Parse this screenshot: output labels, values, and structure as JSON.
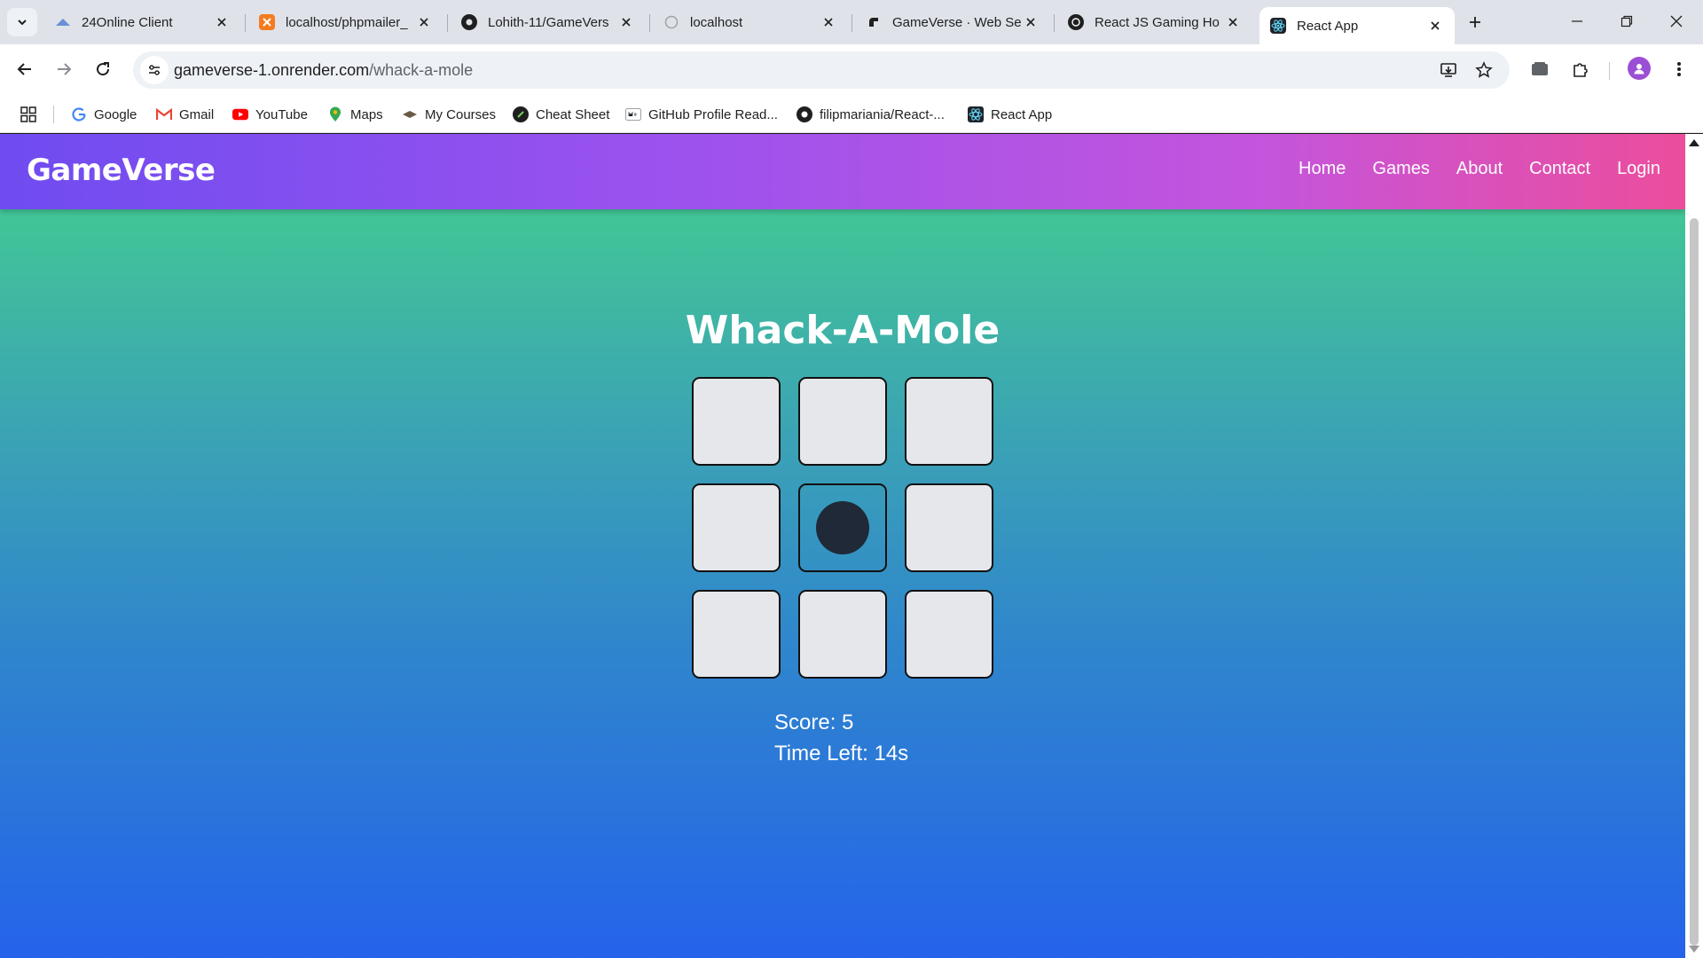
{
  "browser": {
    "tabs": [
      {
        "title": "24Online Client",
        "icon": "cloud-icon"
      },
      {
        "title": "localhost/phpmailer_",
        "icon": "xampp-icon"
      },
      {
        "title": "Lohith-11/GameVers",
        "icon": "github-icon"
      },
      {
        "title": "localhost",
        "icon": "globe-icon"
      },
      {
        "title": "GameVerse · Web Se",
        "icon": "render-icon"
      },
      {
        "title": "React JS Gaming Ho",
        "icon": "chatgpt-icon"
      },
      {
        "title": "React App",
        "icon": "react-icon",
        "active": true
      }
    ],
    "url_domain": "gameverse-1.onrender.com",
    "url_path": "/whack-a-mole",
    "bookmarks": [
      {
        "label": "Google",
        "icon": "google-icon"
      },
      {
        "label": "Gmail",
        "icon": "gmail-icon"
      },
      {
        "label": "YouTube",
        "icon": "youtube-icon"
      },
      {
        "label": "Maps",
        "icon": "maps-icon"
      },
      {
        "label": "My Courses",
        "icon": "courses-icon"
      },
      {
        "label": "Cheat Sheet",
        "icon": "cheatsheet-icon"
      },
      {
        "label": "GitHub Profile Read...",
        "icon": "readme-icon"
      },
      {
        "label": "filipmariania/React-...",
        "icon": "github-icon"
      },
      {
        "label": "React App",
        "icon": "react-icon"
      }
    ]
  },
  "page": {
    "brand": "GameVerse",
    "nav": [
      "Home",
      "Games",
      "About",
      "Contact",
      "Login"
    ],
    "title": "Whack-A-Mole",
    "grid": {
      "size": 9,
      "mole_index": 4
    },
    "score_text": "Score: 5",
    "time_text": "Time Left: 14s"
  },
  "colors": {
    "navbar_gradient": [
      "#6f4cf0",
      "#9c52ee",
      "#c455dc",
      "#ec4d9c"
    ],
    "page_gradient_top": "#44d18c",
    "page_gradient_bottom": "#2563eb",
    "hole": "#e5e7eb",
    "mole": "#1f2937"
  }
}
